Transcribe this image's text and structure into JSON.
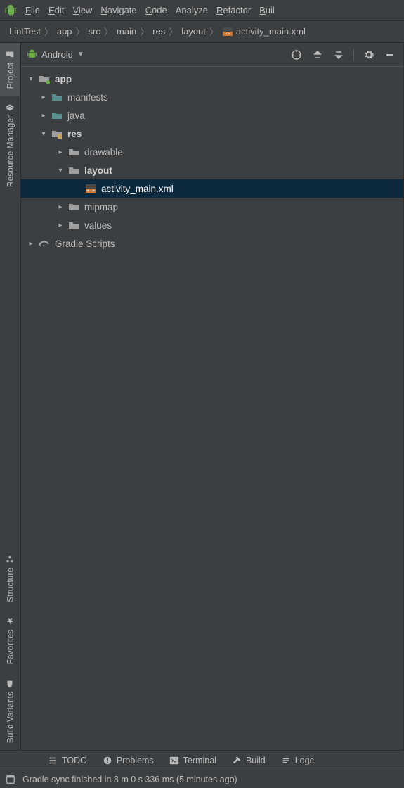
{
  "menu": {
    "items": [
      {
        "mn": "F",
        "rest": "ile"
      },
      {
        "mn": "E",
        "rest": "dit"
      },
      {
        "mn": "V",
        "rest": "iew"
      },
      {
        "mn": "N",
        "rest": "avigate"
      },
      {
        "mn": "C",
        "rest": "ode"
      },
      {
        "mn": "",
        "rest": "Analyze"
      },
      {
        "mn": "R",
        "rest": "efactor"
      },
      {
        "mn": "B",
        "rest": "uil"
      }
    ]
  },
  "breadcrumb": {
    "items": [
      "LintTest",
      "app",
      "src",
      "main",
      "res",
      "layout"
    ],
    "tail": "activity_main.xml"
  },
  "toolstrip": {
    "tabs": [
      "Project",
      "Resource Manager",
      "Structure",
      "Favorites",
      "Build Variants"
    ]
  },
  "panel": {
    "title": "Android"
  },
  "tree": {
    "app": "app",
    "manifests": "manifests",
    "java": "java",
    "res": "res",
    "drawable": "drawable",
    "layout": "layout",
    "activity_main": "activity_main.xml",
    "mipmap": "mipmap",
    "values": "values",
    "gradle": "Gradle Scripts"
  },
  "bottom": {
    "todo": "TODO",
    "problems": "Problems",
    "terminal": "Terminal",
    "build": "Build",
    "logcat": "Logc"
  },
  "status": {
    "text": "Gradle sync finished in 8 m 0 s 336 ms (5 minutes ago)"
  }
}
